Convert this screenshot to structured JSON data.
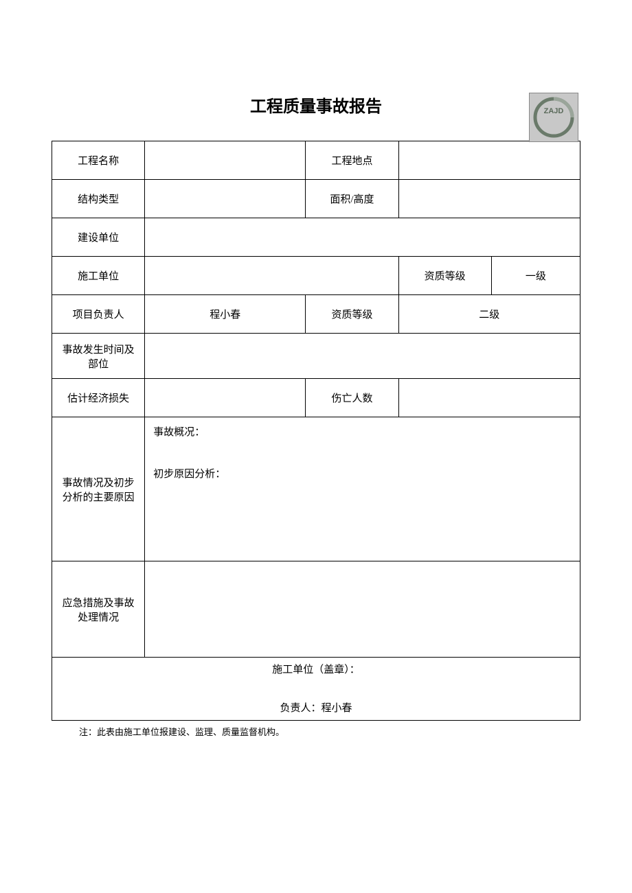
{
  "logo_text": "ZAJD",
  "title": "工程质量事故报告",
  "labels": {
    "project_name": "工程名称",
    "project_location": "工程地点",
    "structure_type": "结构类型",
    "area_height": "面积/高度",
    "developer": "建设单位",
    "contractor": "施工单位",
    "qualification_level_1": "资质等级",
    "project_leader": "项目负责人",
    "qualification_level_2": "资质等级",
    "accident_time_location": "事故发生时间及部位",
    "estimated_loss": "估计经济损失",
    "casualties": "伤亡人数",
    "accident_analysis": "事故情况及初步分析的主要原因",
    "accident_overview": "事故概况：",
    "preliminary_analysis": "初步原因分析：",
    "emergency_measures": "应急措施及事故处理情况",
    "contractor_stamp": "施工单位（盖章）：",
    "responsible_prefix": "负责人："
  },
  "values": {
    "project_name": "",
    "project_location": "",
    "structure_type": "",
    "area_height": "",
    "developer": "",
    "contractor": "",
    "qualification_level_1_value": "一级",
    "project_leader_value": "程小春",
    "qualification_level_2_value": "二级",
    "accident_time_location": "",
    "estimated_loss": "",
    "casualties": "",
    "accident_overview": "",
    "preliminary_analysis": "",
    "emergency_measures": "",
    "responsible_person": "程小春"
  },
  "note": "注：此表由施工单位报建设、监理、质量监督机构。"
}
